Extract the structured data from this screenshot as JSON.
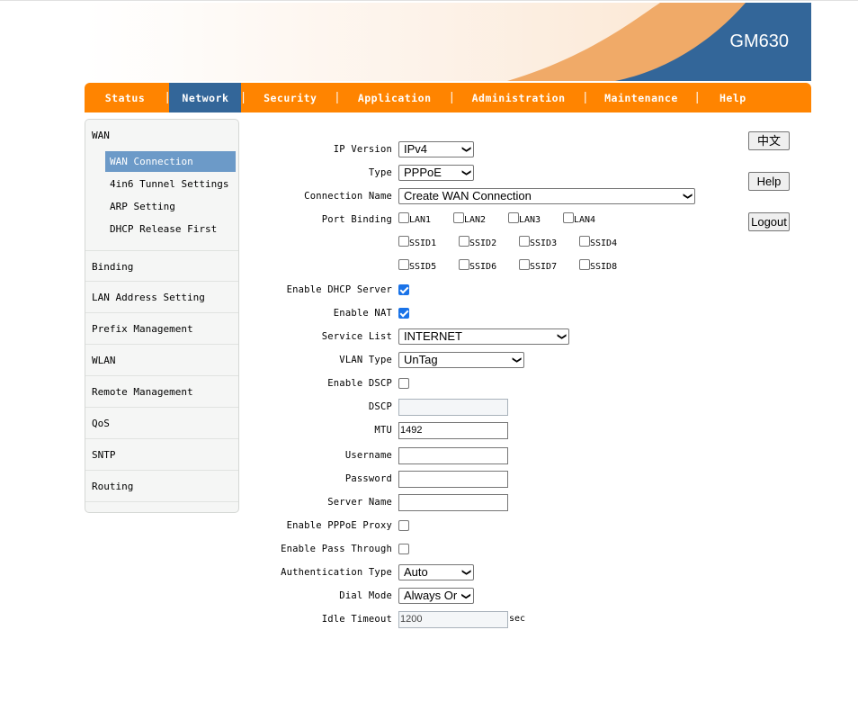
{
  "header": {
    "model": "GM630"
  },
  "nav": {
    "items": [
      {
        "label": "Status",
        "active": false
      },
      {
        "label": "Network",
        "active": true
      },
      {
        "label": "Security",
        "active": false
      },
      {
        "label": "Application",
        "active": false
      },
      {
        "label": "Administration",
        "active": false
      },
      {
        "label": "Maintenance",
        "active": false
      },
      {
        "label": "Help",
        "active": false
      }
    ]
  },
  "sidebar": {
    "section": "WAN",
    "subitems": [
      "WAN Connection",
      "4in6 Tunnel Settings",
      "ARP Setting",
      "DHCP Release First"
    ],
    "items": [
      "Binding",
      "LAN Address Setting",
      "Prefix Management",
      "WLAN",
      "Remote Management",
      "QoS",
      "SNTP",
      "Routing"
    ]
  },
  "buttons": {
    "lang": "中文",
    "help": "Help",
    "logout": "Logout"
  },
  "form": {
    "ip_version": {
      "label": "IP Version",
      "value": "IPv4"
    },
    "type": {
      "label": "Type",
      "value": "PPPoE"
    },
    "connection_name": {
      "label": "Connection Name",
      "value": "Create WAN Connection"
    },
    "port_binding": {
      "label": "Port Binding",
      "ports": [
        "LAN1",
        "LAN2",
        "LAN3",
        "LAN4",
        "SSID1",
        "SSID2",
        "SSID3",
        "SSID4",
        "SSID5",
        "SSID6",
        "SSID7",
        "SSID8"
      ]
    },
    "enable_dhcp_server": {
      "label": "Enable DHCP Server",
      "checked": true
    },
    "enable_nat": {
      "label": "Enable NAT",
      "checked": true
    },
    "service_list": {
      "label": "Service List",
      "value": "INTERNET"
    },
    "vlan_type": {
      "label": "VLAN Type",
      "value": "UnTag"
    },
    "enable_dscp": {
      "label": "Enable DSCP",
      "checked": false
    },
    "dscp": {
      "label": "DSCP",
      "value": ""
    },
    "mtu": {
      "label": "MTU",
      "value": "1492"
    },
    "username": {
      "label": "Username",
      "value": ""
    },
    "password": {
      "label": "Password",
      "value": ""
    },
    "server_name": {
      "label": "Server Name",
      "value": ""
    },
    "enable_pppoe_proxy": {
      "label": "Enable PPPoE Proxy",
      "checked": false
    },
    "enable_pass_through": {
      "label": "Enable Pass Through",
      "checked": false
    },
    "auth_type": {
      "label": "Authentication Type",
      "value": "Auto"
    },
    "dial_mode": {
      "label": "Dial Mode",
      "value": "Always Or"
    },
    "idle_timeout": {
      "label": "Idle Timeout",
      "value": "1200",
      "unit": "sec"
    }
  },
  "colors": {
    "nav": "#ff8400",
    "active_nav": "#336699",
    "active_sub": "#6c9ac8",
    "banner_blue": "#336699",
    "banner_orange": "#f0aa68"
  }
}
